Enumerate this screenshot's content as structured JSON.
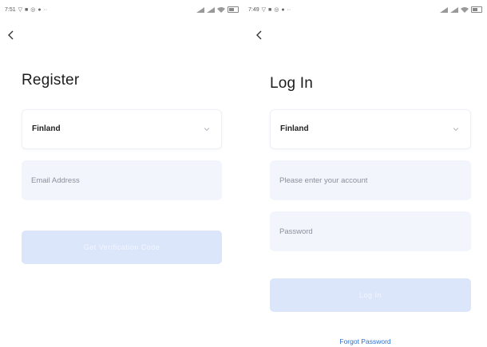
{
  "register": {
    "status_time": "7:51",
    "title": "Register",
    "country_value": "Finland",
    "email_placeholder": "Email Address",
    "submit_label": "Get Verification Code"
  },
  "login": {
    "status_time": "7:49",
    "title": "Log In",
    "country_value": "Finland",
    "account_placeholder": "Please enter your account",
    "password_placeholder": "Password",
    "submit_label": "Log In",
    "forgot_password_label": "Forgot Password"
  },
  "colors": {
    "input_bg": "#f3f5fd",
    "button_disabled_bg": "#dce6fb",
    "link": "#2d6fd3"
  }
}
